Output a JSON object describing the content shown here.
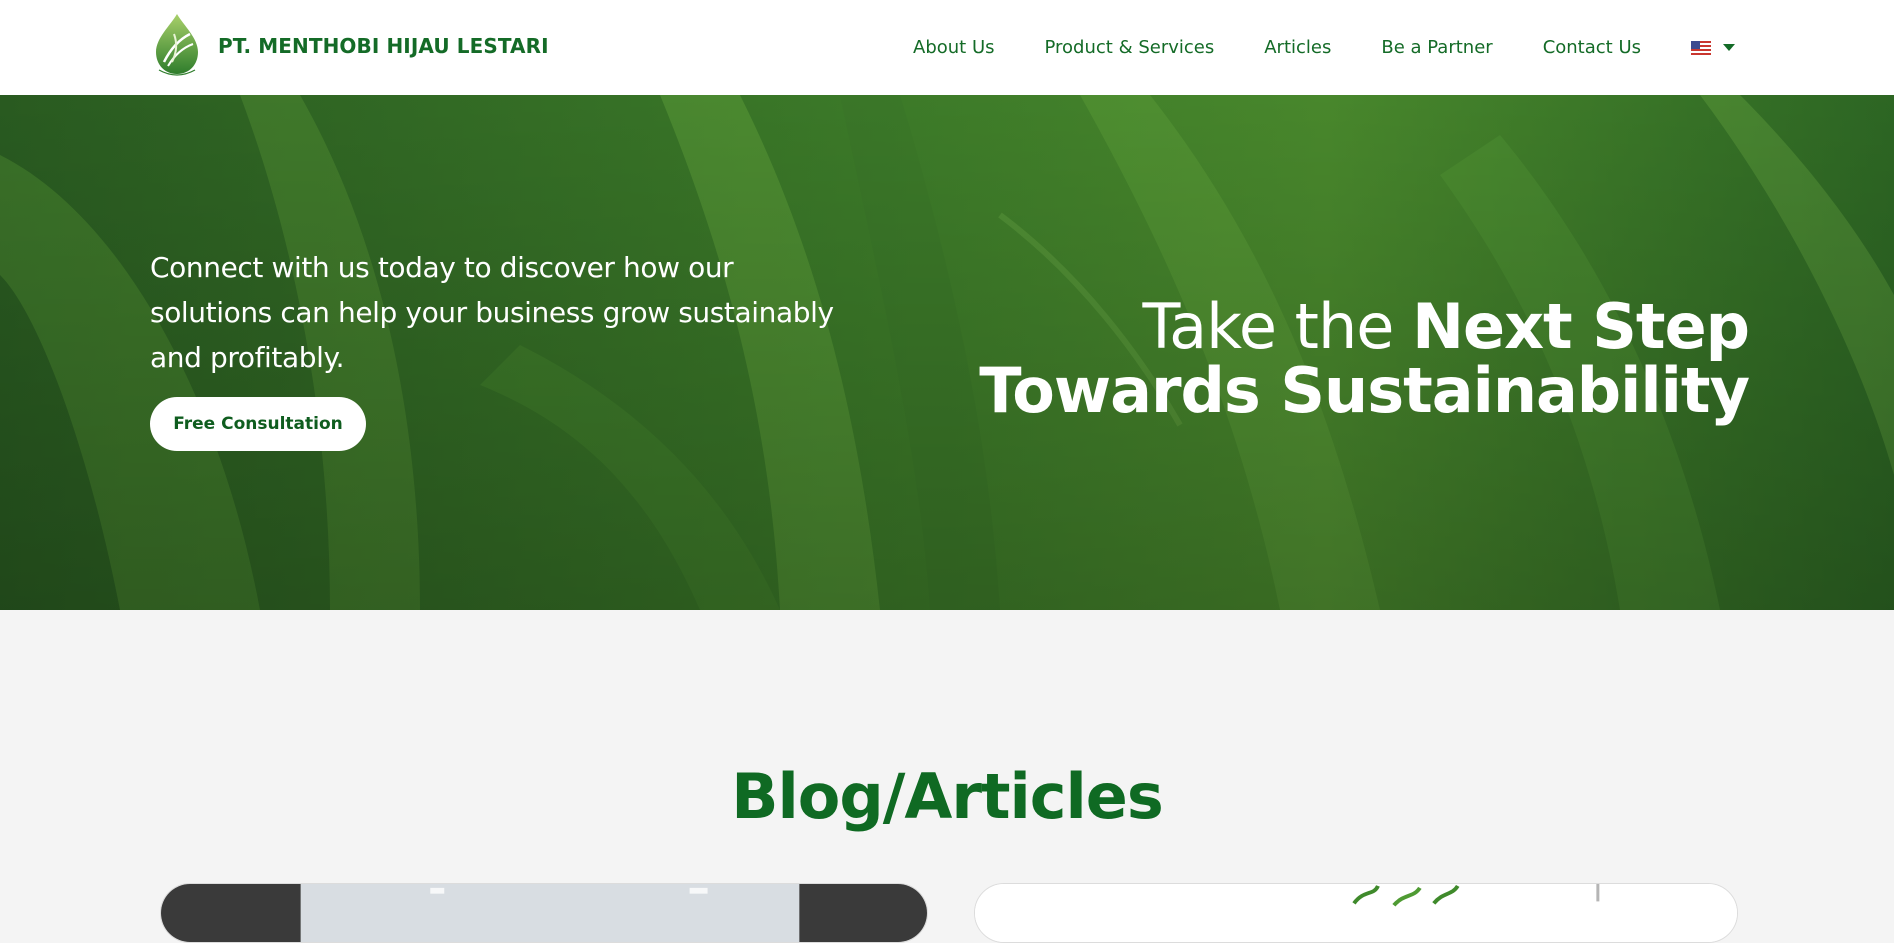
{
  "header": {
    "company_name": "PT. MENTHOBI HIJAU LESTARI",
    "logo_icon": "leaf-drop-logo",
    "nav": [
      {
        "label": "About Us"
      },
      {
        "label": "Product & Services"
      },
      {
        "label": "Articles"
      },
      {
        "label": "Be a Partner"
      },
      {
        "label": "Contact Us"
      }
    ],
    "language_icon": "us-flag-icon"
  },
  "hero": {
    "description": "Connect with us today to discover how our solutions can help your business grow sustainably and profitably.",
    "cta_label": "Free Consultation",
    "title_light": "Take the ",
    "title_bold_1": "Next Step",
    "title_bold_2": "Towards Sustainability",
    "background": "green-leaves-photo"
  },
  "blog": {
    "title": "Blog/Articles"
  },
  "colors": {
    "brand_green": "#146b27",
    "hero_overlay": "#2a6e24",
    "white": "#ffffff",
    "section_bg": "#f4f4f4"
  }
}
